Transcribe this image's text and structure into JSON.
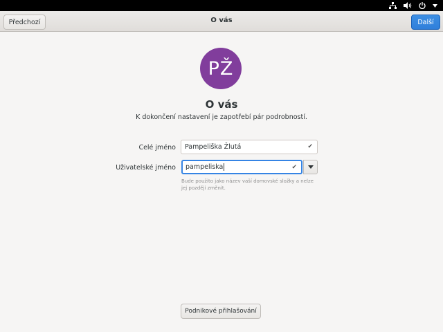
{
  "headerbar": {
    "prev_label": "Předchozí",
    "title": "O vás",
    "next_label": "Další"
  },
  "avatar": {
    "initials": "PŽ",
    "color": "#813d9c"
  },
  "page": {
    "heading": "O vás",
    "subtitle": "K dokončení nastavení je zapotřebí pár podrobností."
  },
  "form": {
    "fullname_label": "Celé jméno",
    "fullname_value": "Pampeliška Žlutá",
    "username_label": "Uživatelské jméno",
    "username_value": "pampeliska",
    "hint": "Bude použito jako název vaší domovské složky a nelze jej později změnit."
  },
  "enterprise_label": "Podnikové přihlašování",
  "colors": {
    "accent": "#3584e4",
    "background": "#f6f5f4"
  },
  "tray_icons": [
    "network-wired-icon",
    "volume-icon",
    "power-icon",
    "chevron-down-icon"
  ]
}
